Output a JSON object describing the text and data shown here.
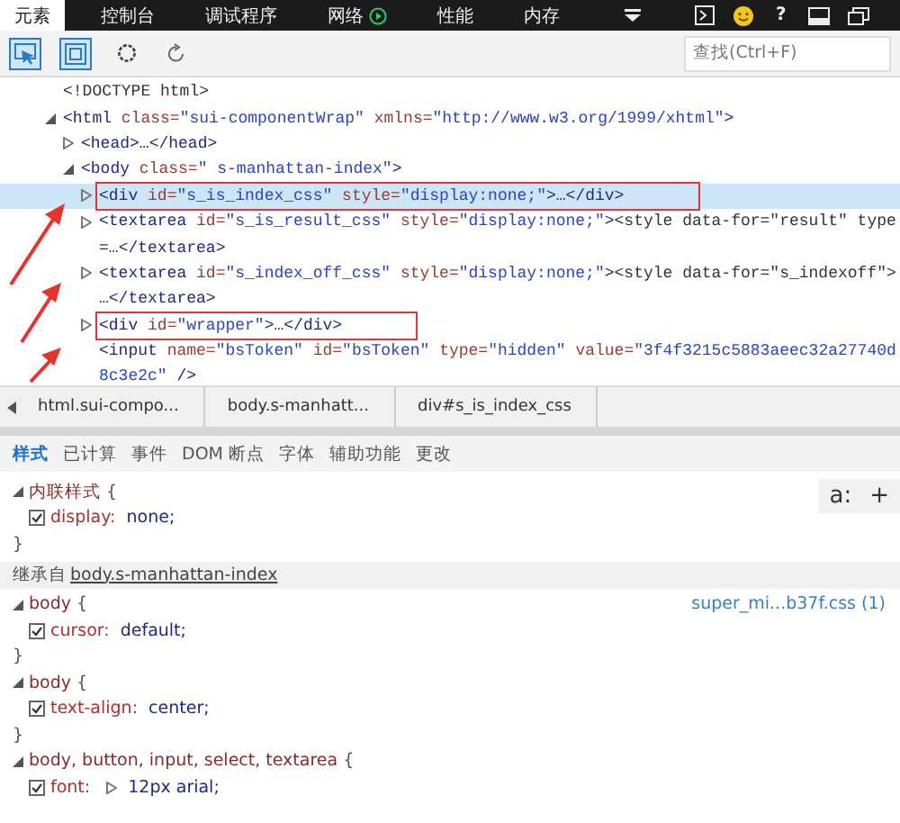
{
  "top_tabs": [
    {
      "label": "元素",
      "selected": true
    },
    {
      "label": "控制台",
      "selected": false
    },
    {
      "label": "调试程序",
      "selected": false
    },
    {
      "label": "网络",
      "selected": false,
      "kind": "play"
    },
    {
      "label": "性能",
      "selected": false
    },
    {
      "label": "内存",
      "selected": false
    }
  ],
  "help_button": "?",
  "tools": [
    {
      "kind": "select",
      "selected": true
    },
    {
      "kind": "box",
      "selected": true
    },
    {
      "kind": "circle",
      "selected": false
    },
    {
      "kind": "refresh",
      "selected": false
    }
  ],
  "search": {
    "placeholder": "查找(Ctrl+F)"
  },
  "dom_tree": [
    {
      "kind": "leaf",
      "selected": false,
      "outlined": false,
      "lines": [
        [
          {
            "kind": "p",
            "text": "<!DOCTYPE html>"
          }
        ]
      ]
    },
    {
      "kind": "node",
      "expanded": true,
      "selected": false,
      "outlined": false,
      "lines": [
        [
          {
            "kind": "tag",
            "text": "<html "
          },
          {
            "kind": "attr",
            "text": "class="
          },
          {
            "kind": "val",
            "text": "\"sui-componentWrap\" "
          },
          {
            "kind": "attr",
            "text": "xmlns="
          },
          {
            "kind": "val",
            "text": "\"http://www.w3.org/1999/xhtml\""
          },
          {
            "kind": "tag",
            "text": ">"
          }
        ]
      ],
      "children": [
        {
          "kind": "node",
          "expanded": false,
          "selected": false,
          "outlined": false,
          "lines": [
            [
              {
                "kind": "tag",
                "text": "<head>"
              },
              {
                "kind": "p",
                "text": "…"
              },
              {
                "kind": "tag",
                "text": "</head>"
              }
            ]
          ]
        },
        {
          "kind": "node",
          "expanded": true,
          "selected": false,
          "outlined": false,
          "lines": [
            [
              {
                "kind": "tag",
                "text": "<body "
              },
              {
                "kind": "attr",
                "text": "class="
              },
              {
                "kind": "val",
                "text": "\" s-manhattan-index\""
              },
              {
                "kind": "tag",
                "text": ">"
              }
            ]
          ],
          "children": [
            {
              "kind": "node",
              "expanded": false,
              "selected": true,
              "outlined": true,
              "lines": [
                [
                  {
                    "kind": "tag",
                    "text": "<div "
                  },
                  {
                    "kind": "attr",
                    "text": "id="
                  },
                  {
                    "kind": "val",
                    "text": "\"s_is_index_css\" "
                  },
                  {
                    "kind": "attr",
                    "text": "style="
                  },
                  {
                    "kind": "val",
                    "text": "\"display:none;\""
                  },
                  {
                    "kind": "tag",
                    "text": ">"
                  },
                  {
                    "kind": "p",
                    "text": "…"
                  },
                  {
                    "kind": "tag",
                    "text": "</div>"
                  }
                ]
              ]
            },
            {
              "kind": "node",
              "expanded": false,
              "selected": false,
              "outlined": false,
              "lines": [
                [
                  {
                    "kind": "tag",
                    "text": "<textarea "
                  },
                  {
                    "kind": "attr",
                    "text": "id="
                  },
                  {
                    "kind": "val",
                    "text": "\"s_is_result_css\" "
                  },
                  {
                    "kind": "attr",
                    "text": "style="
                  },
                  {
                    "kind": "val",
                    "text": "\"display:none;\""
                  },
                  {
                    "kind": "tag",
                    "text": ">"
                  },
                  {
                    "kind": "p",
                    "text": "<style data-for=\"result\" type"
                  }
                ],
                [
                  {
                    "kind": "p",
                    "text": "=…"
                  },
                  {
                    "kind": "tag",
                    "text": "</textarea>"
                  }
                ]
              ]
            },
            {
              "kind": "node",
              "expanded": false,
              "selected": false,
              "outlined": false,
              "lines": [
                [
                  {
                    "kind": "tag",
                    "text": "<textarea "
                  },
                  {
                    "kind": "attr",
                    "text": "id="
                  },
                  {
                    "kind": "val",
                    "text": "\"s_index_off_css\" "
                  },
                  {
                    "kind": "attr",
                    "text": "style="
                  },
                  {
                    "kind": "val",
                    "text": "\"display:none;\""
                  },
                  {
                    "kind": "tag",
                    "text": ">"
                  },
                  {
                    "kind": "p",
                    "text": "<style data-for=\"s_indexoff\">"
                  }
                ],
                [
                  {
                    "kind": "p",
                    "text": "…"
                  },
                  {
                    "kind": "tag",
                    "text": "</textarea>"
                  }
                ]
              ]
            },
            {
              "kind": "node",
              "expanded": false,
              "selected": false,
              "outlined": true,
              "lines": [
                [
                  {
                    "kind": "tag",
                    "text": "<div "
                  },
                  {
                    "kind": "attr",
                    "text": "id="
                  },
                  {
                    "kind": "val",
                    "text": "\"wrapper\""
                  },
                  {
                    "kind": "tag",
                    "text": ">"
                  },
                  {
                    "kind": "p",
                    "text": "…"
                  },
                  {
                    "kind": "tag",
                    "text": "</div>"
                  }
                ]
              ]
            },
            {
              "kind": "leaf",
              "selected": false,
              "outlined": false,
              "lines": [
                [
                  {
                    "kind": "tag",
                    "text": "<input "
                  },
                  {
                    "kind": "attr",
                    "text": "name="
                  },
                  {
                    "kind": "val",
                    "text": "\"bsToken\" "
                  },
                  {
                    "kind": "attr",
                    "text": "id="
                  },
                  {
                    "kind": "val",
                    "text": "\"bsToken\" "
                  },
                  {
                    "kind": "attr",
                    "text": "type="
                  },
                  {
                    "kind": "val",
                    "text": "\"hidden\" "
                  },
                  {
                    "kind": "attr",
                    "text": "value="
                  },
                  {
                    "kind": "val",
                    "text": "\"3f4f3215c5883aeec32a27740d"
                  }
                ],
                [
                  {
                    "kind": "val",
                    "text": "8c3e2c\" "
                  },
                  {
                    "kind": "tag",
                    "text": "/>"
                  }
                ]
              ]
            }
          ]
        }
      ]
    }
  ],
  "breadcrumbs": [
    "html.sui-compo...",
    "body.s-manhatt...",
    "div#s_is_index_css"
  ],
  "style_tabs": [
    {
      "label": "样式",
      "selected": true
    },
    {
      "label": "已计算",
      "selected": false
    },
    {
      "label": "事件",
      "selected": false
    },
    {
      "label": "DOM 断点",
      "selected": false
    },
    {
      "label": "字体",
      "selected": false
    },
    {
      "label": "辅助功能",
      "selected": false
    },
    {
      "label": "更改",
      "selected": false
    }
  ],
  "pane_buttons": [
    "a:",
    "+"
  ],
  "rules": [
    {
      "kind": "rule",
      "selector": "内联样式",
      "open_brace": "{",
      "close_brace": "}",
      "props": [
        {
          "name": "display:",
          "value": "none;",
          "checked": true
        }
      ]
    },
    {
      "kind": "inherited",
      "label": "继承自",
      "link": "body.s-manhattan-index"
    },
    {
      "kind": "rule",
      "selector": "body",
      "open_brace": "{",
      "close_brace": "}",
      "source": "super_mi...b37f.css (1)",
      "props": [
        {
          "name": "cursor:",
          "value": "default;",
          "checked": true
        }
      ]
    },
    {
      "kind": "rule",
      "selector": "body",
      "open_brace": "{",
      "close_brace": "}",
      "props": [
        {
          "name": "text-align:",
          "value": "center;",
          "checked": true
        }
      ]
    },
    {
      "kind": "rule",
      "selector": "body, button, input, select, textarea",
      "open_brace": "{",
      "props": [
        {
          "name": "font:",
          "value": "12px arial;",
          "checked": true,
          "expandable": true
        }
      ]
    }
  ]
}
